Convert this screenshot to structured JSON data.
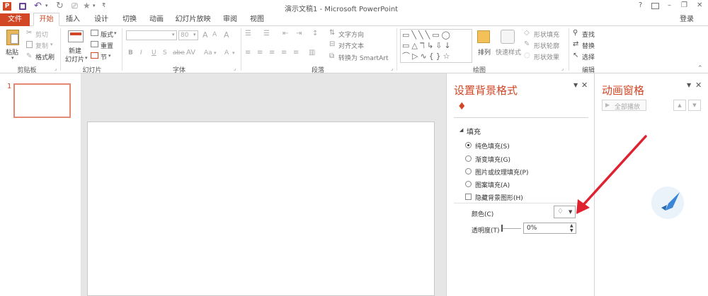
{
  "window": {
    "title": "演示文稿1 - Microsoft PowerPoint",
    "login": "登录",
    "help": "?",
    "controls": [
      "?",
      "▭",
      "–",
      "❐",
      "✕"
    ]
  },
  "tabs": [
    "文件",
    "开始",
    "插入",
    "设计",
    "切换",
    "动画",
    "幻灯片放映",
    "审阅",
    "视图"
  ],
  "ribbon": {
    "clipboard": {
      "paste": "粘贴",
      "cut": "剪切",
      "copy": "复制",
      "painter": "格式刷",
      "label": "剪贴板"
    },
    "slides": {
      "new": "新建",
      "new2": "幻灯片",
      "layout": "版式",
      "reset": "重置",
      "section": "节",
      "label": "幻灯片"
    },
    "font": {
      "size": "80",
      "label": "字体",
      "bold": "B",
      "italic": "I",
      "underline": "U",
      "strike": "S",
      "shadow": "abe",
      "aa1": "A",
      "aa2": "A",
      "aa3": "Aa",
      "clear": "A"
    },
    "paragraph": {
      "direction": "文字方向",
      "align": "对齐文本",
      "smartart": "转换为 SmartArt",
      "label": "段落"
    },
    "drawing": {
      "arrange": "排列",
      "quickstyle": "快速样式",
      "fill": "形状填充",
      "outline": "形状轮廓",
      "effect": "形状效果",
      "label": "绘图"
    },
    "editing": {
      "find": "查找",
      "replace": "替换",
      "select": "选择",
      "label": "编辑"
    }
  },
  "thumbnail": {
    "number": "1"
  },
  "format_bg": {
    "title": "设置背景格式",
    "section": "填充",
    "options": [
      "纯色填充(S)",
      "渐变填充(G)",
      "图片或纹理填充(P)",
      "图案填充(A)"
    ],
    "selected_index": 0,
    "hide_bg": "隐藏背景图形(H)",
    "color_label": "颜色(C)",
    "transparency_label": "透明度(T)",
    "transparency_value": "0%"
  },
  "anim": {
    "title": "动画窗格",
    "play_all": "全部播放"
  },
  "colors": {
    "accent": "#d24726",
    "arrow": "#e0212f"
  }
}
